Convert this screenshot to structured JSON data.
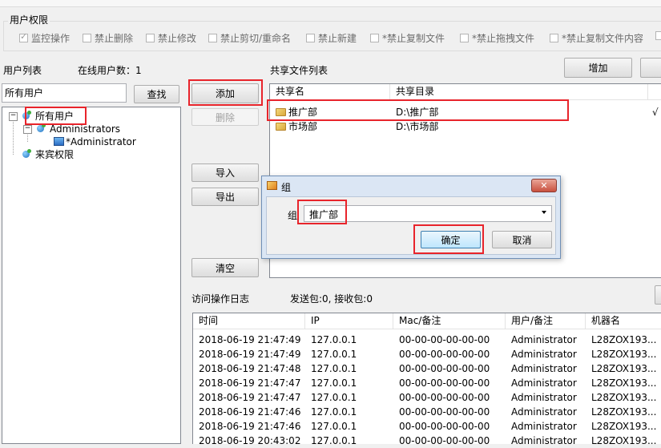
{
  "permissions": {
    "title": "用户权限",
    "items": [
      {
        "label": "监控操作",
        "checked": true
      },
      {
        "label": "禁止删除",
        "checked": false
      },
      {
        "label": "禁止修改",
        "checked": false
      },
      {
        "label": "禁止剪切/重命名",
        "checked": false
      },
      {
        "label": "禁止新建",
        "checked": false
      },
      {
        "label": "*禁止复制文件",
        "checked": false
      },
      {
        "label": "*禁止拖拽文件",
        "checked": false
      },
      {
        "label": "*禁止复制文件内容",
        "checked": false
      }
    ]
  },
  "users": {
    "title": "用户列表",
    "online_label": "在线用户数：1",
    "search_value": "所有用户",
    "search_button": "查找",
    "tree": {
      "root": "所有用户",
      "group": "Administrators",
      "user": "*Administrator",
      "guest": "来宾权限"
    }
  },
  "middle_buttons": {
    "add": "添加",
    "delete": "删除",
    "import": "导入",
    "export": "导出",
    "clear": "清空"
  },
  "shares": {
    "title": "共享文件列表",
    "add_button": "增加",
    "headers": [
      "共享名",
      "共享目录"
    ],
    "rows": [
      {
        "name": "推广部",
        "path": "D:\\推广部",
        "mark": "√"
      },
      {
        "name": "市场部",
        "path": "D:\\市场部",
        "mark": ""
      }
    ]
  },
  "dialog": {
    "title": "组",
    "close": "✕",
    "field_label": "组",
    "selected": "推广部",
    "ok": "确定",
    "cancel": "取消"
  },
  "log": {
    "title": "访问操作日志",
    "stats": "发送包:0, 接收包:0",
    "headers": [
      "时间",
      "IP",
      "Mac/备注",
      "用户/备注",
      "机器名"
    ],
    "rows": [
      [
        "2018-06-19 21:47:49",
        "127.0.0.1",
        "00-00-00-00-00-00",
        "Administrator",
        "L28ZOX193..."
      ],
      [
        "2018-06-19 21:47:49",
        "127.0.0.1",
        "00-00-00-00-00-00",
        "Administrator",
        "L28ZOX193..."
      ],
      [
        "2018-06-19 21:47:48",
        "127.0.0.1",
        "00-00-00-00-00-00",
        "Administrator",
        "L28ZOX193..."
      ],
      [
        "2018-06-19 21:47:47",
        "127.0.0.1",
        "00-00-00-00-00-00",
        "Administrator",
        "L28ZOX193..."
      ],
      [
        "2018-06-19 21:47:47",
        "127.0.0.1",
        "00-00-00-00-00-00",
        "Administrator",
        "L28ZOX193..."
      ],
      [
        "2018-06-19 21:47:46",
        "127.0.0.1",
        "00-00-00-00-00-00",
        "Administrator",
        "L28ZOX193..."
      ],
      [
        "2018-06-19 21:47:46",
        "127.0.0.1",
        "00-00-00-00-00-00",
        "Administrator",
        "L28ZOX193..."
      ],
      [
        "2018-06-19 20:43:02",
        "127.0.0.1",
        "00-00-00-00-00-00",
        "Administrator",
        "L28ZOX193..."
      ]
    ]
  }
}
